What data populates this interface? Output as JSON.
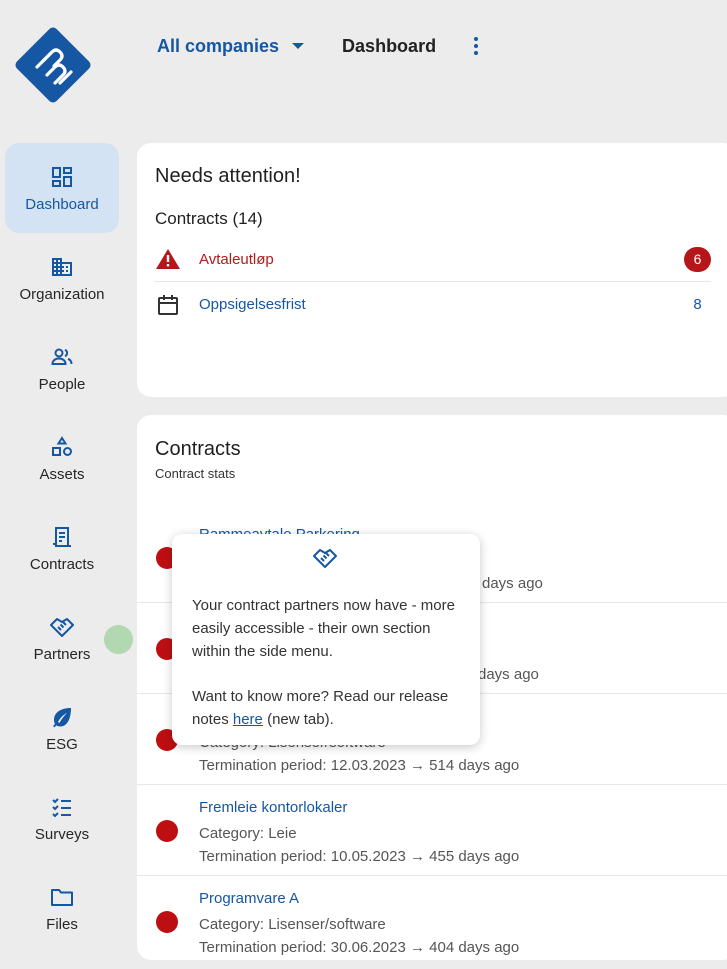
{
  "topbar": {
    "company_label": "All companies",
    "page_title": "Dashboard"
  },
  "sidebar": {
    "items": [
      {
        "label": "Dashboard"
      },
      {
        "label": "Organization"
      },
      {
        "label": "People"
      },
      {
        "label": "Assets"
      },
      {
        "label": "Contracts"
      },
      {
        "label": "Partners"
      },
      {
        "label": "ESG"
      },
      {
        "label": "Surveys"
      },
      {
        "label": "Files"
      }
    ]
  },
  "attention": {
    "title": "Needs attention!",
    "subtitle": "Contracts (14)",
    "rows": [
      {
        "label": "Avtaleutløp",
        "count": "6"
      },
      {
        "label": "Oppsigelsesfrist",
        "count": "8"
      }
    ]
  },
  "contracts": {
    "title": "Contracts",
    "subtitle": "Contract stats",
    "rows": [
      {
        "title": "Rammeavtale Parkering",
        "category": "",
        "term": "days ago"
      },
      {
        "title": "",
        "category": "",
        "term": "days ago"
      },
      {
        "title": "",
        "category": "Category: Lisenser/software",
        "term": "Termination period: 12.03.2023 → 514 days ago"
      },
      {
        "title": "Fremleie kontorlokaler",
        "category": "Category: Leie",
        "term": "Termination period: 10.05.2023 → 455 days ago"
      },
      {
        "title": "Programvare A",
        "category": "Category: Lisenser/software",
        "term": "Termination period: 30.06.2023 → 404 days ago"
      }
    ]
  },
  "popup": {
    "text1": "Your contract partners now have - more easily accessible - their own section within the side menu.",
    "text2_before": "Want to know more? Read our release notes ",
    "link": "here",
    "text2_after": " (new tab)."
  },
  "colors": {
    "accent": "#1657a4",
    "alert_red": "#bd0f12",
    "active_nav_bg": "#d3e3f4",
    "background": "#ececec"
  }
}
